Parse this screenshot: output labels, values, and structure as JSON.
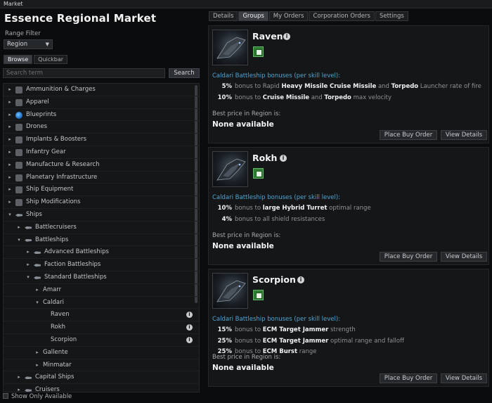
{
  "window": {
    "title": "Market"
  },
  "left": {
    "market_title": "Essence Regional Market",
    "range_filter_label": "Range Filter",
    "range_filter_value": "Region",
    "subtabs": [
      "Browse",
      "Quickbar"
    ],
    "search_placeholder": "Search term",
    "search_button": "Search",
    "tree": [
      {
        "label": "Ammunition & Charges",
        "depth": 0,
        "arrow": "▸",
        "icon": "ammo-icon"
      },
      {
        "label": "Apparel",
        "depth": 0,
        "arrow": "▸",
        "icon": "apparel-icon"
      },
      {
        "label": "Blueprints",
        "depth": 0,
        "arrow": "▸",
        "icon": "blueprint-icon"
      },
      {
        "label": "Drones",
        "depth": 0,
        "arrow": "▸",
        "icon": "drone-icon"
      },
      {
        "label": "Implants & Boosters",
        "depth": 0,
        "arrow": "▸",
        "icon": "implant-icon"
      },
      {
        "label": "Infantry Gear",
        "depth": 0,
        "arrow": "▸",
        "icon": "infantry-icon"
      },
      {
        "label": "Manufacture & Research",
        "depth": 0,
        "arrow": "▸",
        "icon": "manufacture-icon"
      },
      {
        "label": "Planetary Infrastructure",
        "depth": 0,
        "arrow": "▸",
        "icon": "planetary-icon"
      },
      {
        "label": "Ship Equipment",
        "depth": 0,
        "arrow": "▸",
        "icon": "equipment-icon"
      },
      {
        "label": "Ship Modifications",
        "depth": 0,
        "arrow": "▸",
        "icon": "modification-icon"
      },
      {
        "label": "Ships",
        "depth": 0,
        "arrow": "▾",
        "icon": "ship-icon"
      },
      {
        "label": "Battlecruisers",
        "depth": 1,
        "arrow": "▸",
        "icon": "ship-icon"
      },
      {
        "label": "Battleships",
        "depth": 1,
        "arrow": "▾",
        "icon": "ship-icon"
      },
      {
        "label": "Advanced Battleships",
        "depth": 2,
        "arrow": "▸",
        "icon": "ship-icon"
      },
      {
        "label": "Faction Battleships",
        "depth": 2,
        "arrow": "▸",
        "icon": "ship-icon"
      },
      {
        "label": "Standard Battleships",
        "depth": 2,
        "arrow": "▾",
        "icon": "ship-icon"
      },
      {
        "label": "Amarr",
        "depth": 3,
        "arrow": "▸",
        "icon": ""
      },
      {
        "label": "Caldari",
        "depth": 3,
        "arrow": "▾",
        "icon": ""
      },
      {
        "label": "Raven",
        "depth": 4,
        "arrow": "",
        "icon": "",
        "info": true
      },
      {
        "label": "Rokh",
        "depth": 4,
        "arrow": "",
        "icon": "",
        "info": true
      },
      {
        "label": "Scorpion",
        "depth": 4,
        "arrow": "",
        "icon": "",
        "info": true
      },
      {
        "label": "Gallente",
        "depth": 3,
        "arrow": "▸",
        "icon": ""
      },
      {
        "label": "Minmatar",
        "depth": 3,
        "arrow": "▸",
        "icon": ""
      },
      {
        "label": "Capital Ships",
        "depth": 1,
        "arrow": "▸",
        "icon": "ship-icon"
      },
      {
        "label": "Cruisers",
        "depth": 1,
        "arrow": "▸",
        "icon": "ship-icon"
      }
    ],
    "show_only_available": "Show Only Available"
  },
  "right": {
    "tabs": [
      "Details",
      "Groups",
      "My Orders",
      "Corporation Orders",
      "Settings"
    ],
    "active_tab": "Groups",
    "cards": [
      {
        "name": "Raven",
        "bonus_header": "Caldari Battleship bonuses (per skill level):",
        "bonuses": [
          {
            "pct": "5%",
            "parts": [
              [
                "t",
                "bonus to Rapid "
              ],
              [
                "b",
                "Heavy Missile"
              ],
              [
                "t",
                " "
              ],
              [
                "b",
                "Cruise Missile"
              ],
              [
                "t",
                " and "
              ],
              [
                "b",
                "Torpedo"
              ],
              [
                "t",
                " Launcher rate of fire"
              ]
            ]
          },
          {
            "pct": "10%",
            "parts": [
              [
                "t",
                "bonus to "
              ],
              [
                "b",
                "Cruise Missile"
              ],
              [
                "t",
                " and "
              ],
              [
                "b",
                "Torpedo"
              ],
              [
                "t",
                " max velocity"
              ]
            ]
          }
        ],
        "best_price_label": "Best price in Region is:",
        "best_price_value": "None available",
        "buy_button": "Place Buy Order",
        "details_button": "View Details"
      },
      {
        "name": "Rokh",
        "bonus_header": "Caldari Battleship bonuses (per skill level):",
        "bonuses": [
          {
            "pct": "10%",
            "parts": [
              [
                "t",
                "bonus to "
              ],
              [
                "b",
                "large Hybrid Turret"
              ],
              [
                "t",
                " optimal range"
              ]
            ]
          },
          {
            "pct": "4%",
            "parts": [
              [
                "t",
                "bonus to all shield resistances"
              ]
            ]
          }
        ],
        "best_price_label": "Best price in Region is:",
        "best_price_value": "None available",
        "buy_button": "Place Buy Order",
        "details_button": "View Details"
      },
      {
        "name": "Scorpion",
        "bonus_header": "Caldari Battleship bonuses (per skill level):",
        "bonuses": [
          {
            "pct": "15%",
            "parts": [
              [
                "t",
                "bonus to "
              ],
              [
                "b",
                "ECM Target Jammer"
              ],
              [
                "t",
                " strength"
              ]
            ]
          },
          {
            "pct": "25%",
            "parts": [
              [
                "t",
                "bonus to "
              ],
              [
                "b",
                "ECM Target Jammer"
              ],
              [
                "t",
                " optimal range and falloff"
              ]
            ]
          },
          {
            "pct": "25%",
            "parts": [
              [
                "t",
                "bonus to "
              ],
              [
                "b",
                "ECM Burst"
              ],
              [
                "t",
                " range"
              ]
            ]
          }
        ],
        "best_price_label": "Best price in Region is:",
        "best_price_value": "None available",
        "buy_button": "Place Buy Order",
        "details_button": "View Details"
      }
    ]
  }
}
